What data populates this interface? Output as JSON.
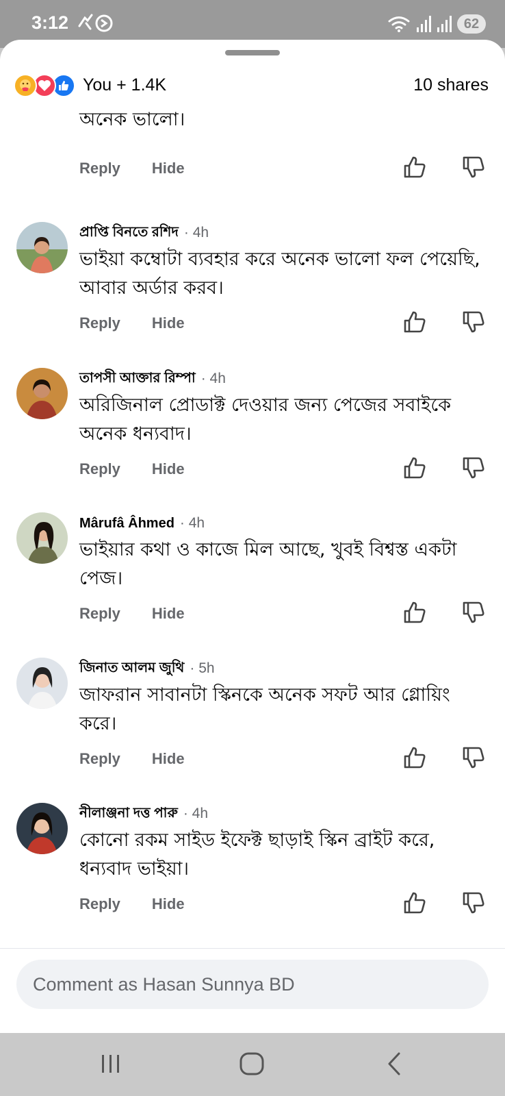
{
  "status_bar": {
    "time": "3:12",
    "battery": "62",
    "left_icons": [
      "call-icon",
      "no-disturb-icon"
    ],
    "right_icons": [
      "wifi-icon",
      "signal-icon",
      "signal-icon"
    ]
  },
  "header": {
    "reaction_icons": [
      "care-icon",
      "love-icon",
      "like-icon"
    ],
    "reactions_label": "You + 1.4K",
    "shares_label": "10 shares"
  },
  "comments": [
    {
      "author": "",
      "time": "",
      "text": "খুবই চমৎকার একটা কম্বো অফার। দাম অনুযায়ী মান অনেক ভালো।",
      "reply": "Reply",
      "hide": "Hide"
    },
    {
      "author": "প্রাপ্তি বিনতে রশিদ",
      "time": "· 4h",
      "text": "ভাইয়া কম্বোটা ব্যবহার করে অনেক ভালো ফল পেয়েছি, আবার অর্ডার করব।",
      "reply": "Reply",
      "hide": "Hide"
    },
    {
      "author": "তাপসী আক্তার রিম্পা",
      "time": "· 4h",
      "text": "অরিজিনাল প্রোডাক্ট দেওয়ার জন্য পেজের সবাইকে অনেক ধন্যবাদ।",
      "reply": "Reply",
      "hide": "Hide"
    },
    {
      "author": "Mârufâ Âhmed",
      "time": "· 4h",
      "text": "ভাইয়ার কথা ও কাজে মিল আছে, খুবই বিশ্বস্ত একটা পেজ।",
      "reply": "Reply",
      "hide": "Hide"
    },
    {
      "author": "জিনাত আলম জুথি",
      "time": "· 5h",
      "text": "জাফরান সাবানটা স্কিনকে অনেক সফট আর গ্লোয়িং করে।",
      "reply": "Reply",
      "hide": "Hide"
    },
    {
      "author": "নীলাঞ্জনা দত্ত পারু",
      "time": "· 4h",
      "text": "কোনো রকম সাইড ইফেক্ট ছাড়াই স্কিন ব্রাইট করে, ধন্যবাদ ভাইয়া।",
      "reply": "Reply",
      "hide": "Hide"
    }
  ],
  "composer": {
    "placeholder": "Comment as Hasan Sunnya BD"
  },
  "nav_bar": {
    "buttons": [
      "recent-apps-icon",
      "home-icon",
      "back-icon"
    ]
  },
  "colors": {
    "like_blue": "#1877f2",
    "love_red": "#f33e58",
    "care_yellow": "#f7b125",
    "secondary_text": "#65676b"
  }
}
